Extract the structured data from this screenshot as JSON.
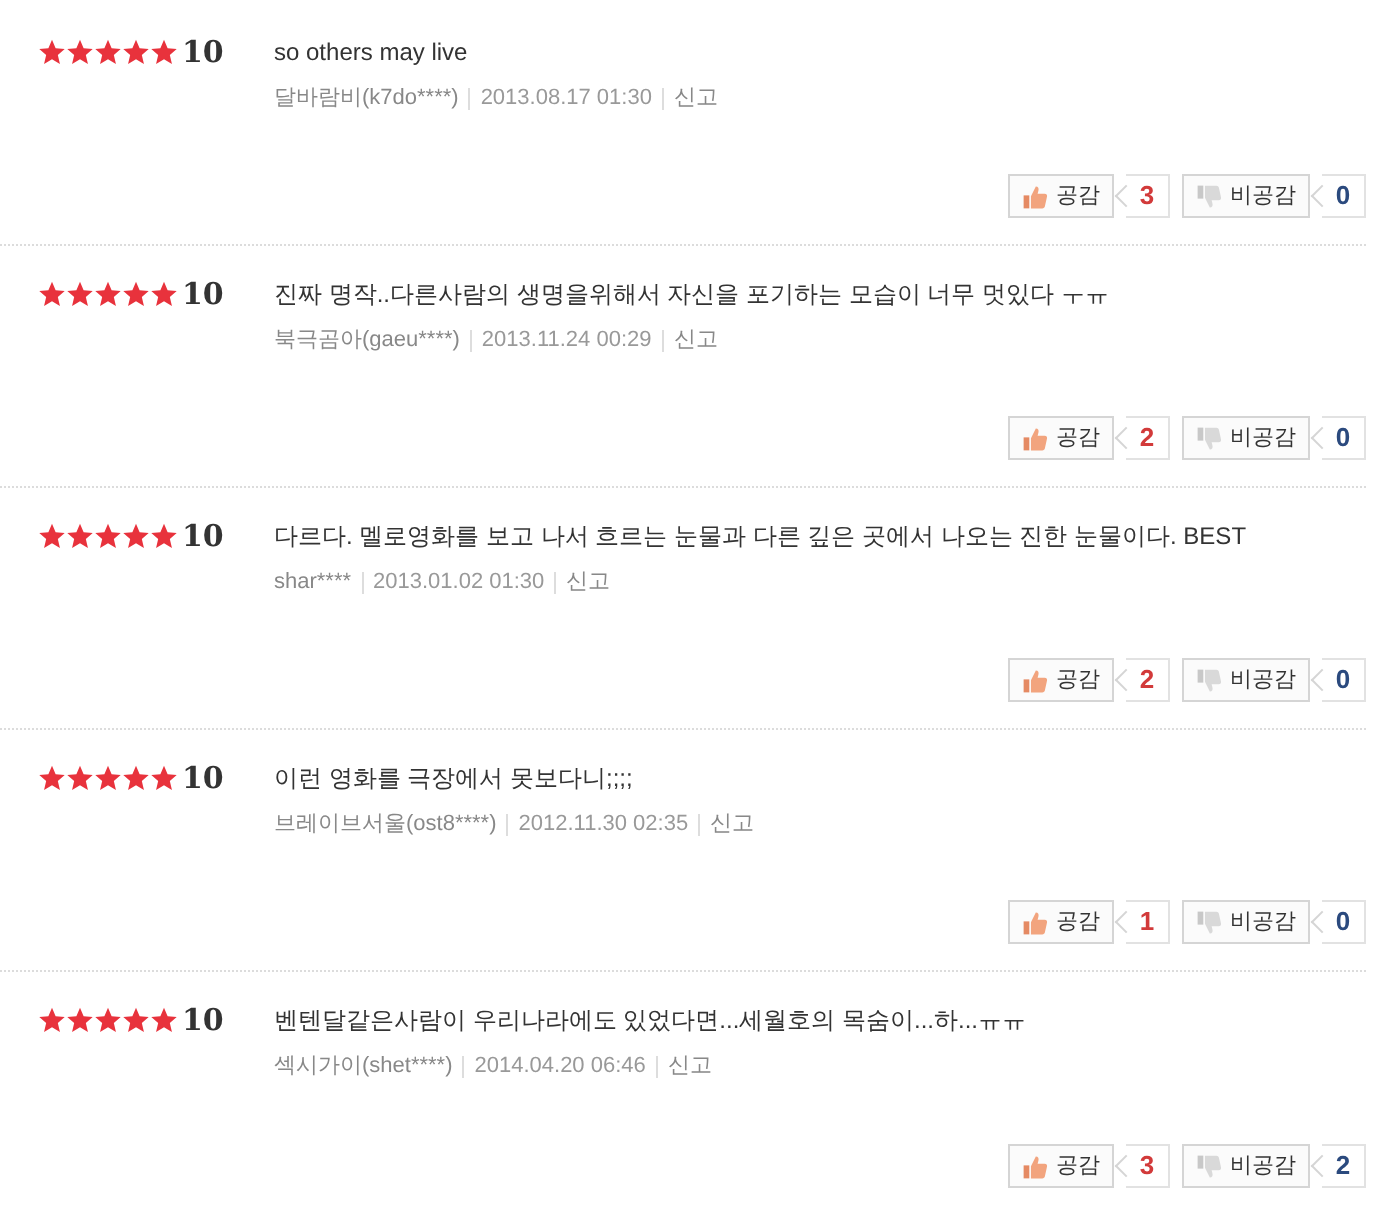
{
  "reviews": [
    {
      "stars": 5,
      "score": "10",
      "text": "so others may live",
      "author": "달바람비(k7do****)",
      "date": "2013.08.17 01:30",
      "report": "신고",
      "like_label": "공감",
      "like_count": "3",
      "dislike_label": "비공감",
      "dislike_count": "0"
    },
    {
      "stars": 5,
      "score": "10",
      "text": "진짜 명작..다른사람의 생명을위해서 자신을 포기하는 모습이 너무 멋있다 ㅜㅠ",
      "author": "북극곰아(gaeu****)",
      "date": "2013.11.24 00:29",
      "report": "신고",
      "like_label": "공감",
      "like_count": "2",
      "dislike_label": "비공감",
      "dislike_count": "0"
    },
    {
      "stars": 5,
      "score": "10",
      "text": "다르다. 멜로영화를 보고 나서 흐르는 눈물과 다른 깊은 곳에서 나오는 진한 눈물이다. BEST",
      "author": "shar****",
      "date": "2013.01.02 01:30",
      "report": "신고",
      "like_label": "공감",
      "like_count": "2",
      "dislike_label": "비공감",
      "dislike_count": "0"
    },
    {
      "stars": 5,
      "score": "10",
      "text": "이런 영화를 극장에서 못보다니;;;;",
      "author": "브레이브서울(ost8****)",
      "date": "2012.11.30 02:35",
      "report": "신고",
      "like_label": "공감",
      "like_count": "1",
      "dislike_label": "비공감",
      "dislike_count": "0"
    },
    {
      "stars": 5,
      "score": "10",
      "text": "벤텐달같은사람이 우리나라에도 있었다면...세월호의 목숨이...하...ㅠㅠ",
      "author": "섹시가이(shet****)",
      "date": "2014.04.20 06:46",
      "report": "신고",
      "like_label": "공감",
      "like_count": "3",
      "dislike_label": "비공감",
      "dislike_count": "2"
    }
  ]
}
